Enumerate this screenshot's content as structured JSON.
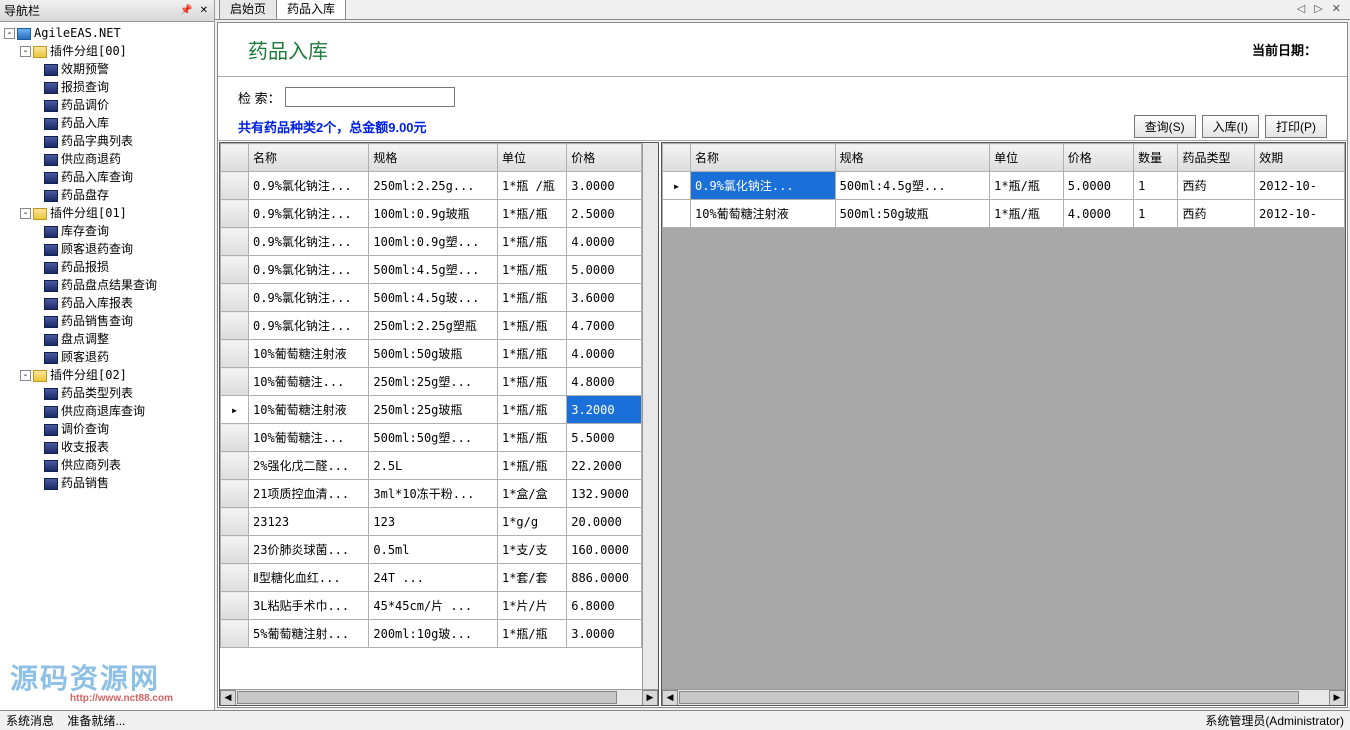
{
  "sidebar": {
    "title": "导航栏",
    "root": "AgileEAS.NET",
    "groups": [
      {
        "label": "插件分组[00]",
        "items": [
          "效期预警",
          "报损查询",
          "药品调价",
          "药品入库",
          "药品字典列表",
          "供应商退药",
          "药品入库查询",
          "药品盘存"
        ]
      },
      {
        "label": "插件分组[01]",
        "items": [
          "库存查询",
          "顾客退药查询",
          "药品报损",
          "药品盘点结果查询",
          "药品入库报表",
          "药品销售查询",
          "盘点调整",
          "顾客退药"
        ]
      },
      {
        "label": "插件分组[02]",
        "items": [
          "药品类型列表",
          "供应商退库查询",
          "调价查询",
          "收支报表",
          "供应商列表",
          "药品销售"
        ]
      }
    ]
  },
  "tabs": {
    "start": "启始页",
    "active": "药品入库"
  },
  "page": {
    "title": "药品入库",
    "date_label": "当前日期："
  },
  "search": {
    "label": "检  索：",
    "value": "",
    "summary": "共有药品种类2个，总金额9.00元"
  },
  "buttons": {
    "query": "查询(S)",
    "in": "入库(I)",
    "print": "打印(P)"
  },
  "left_grid": {
    "cols": [
      "名称",
      "规格",
      "单位",
      "价格"
    ],
    "rows": [
      {
        "name": "0.9%氯化钠注...",
        "spec": "250ml:2.25g...",
        "unit": "1*瓶 /瓶",
        "price": "3.0000"
      },
      {
        "name": "0.9%氯化钠注...",
        "spec": "100ml:0.9g玻瓶",
        "unit": "1*瓶/瓶",
        "price": "2.5000"
      },
      {
        "name": "0.9%氯化钠注...",
        "spec": "100ml:0.9g塑...",
        "unit": "1*瓶/瓶",
        "price": "4.0000"
      },
      {
        "name": "0.9%氯化钠注...",
        "spec": "500ml:4.5g塑...",
        "unit": "1*瓶/瓶",
        "price": "5.0000"
      },
      {
        "name": "0.9%氯化钠注...",
        "spec": "500ml:4.5g玻...",
        "unit": "1*瓶/瓶",
        "price": "3.6000"
      },
      {
        "name": "0.9%氯化钠注...",
        "spec": "250ml:2.25g塑瓶",
        "unit": "1*瓶/瓶",
        "price": "4.7000"
      },
      {
        "name": "10%葡萄糖注射液",
        "spec": "500ml:50g玻瓶",
        "unit": "1*瓶/瓶",
        "price": "4.0000"
      },
      {
        "name": "10%葡萄糖注...",
        "spec": "250ml:25g塑...",
        "unit": "1*瓶/瓶",
        "price": "4.8000"
      },
      {
        "name": "10%葡萄糖注射液",
        "spec": "250ml:25g玻瓶",
        "unit": "1*瓶/瓶",
        "price": "3.2000",
        "selected": true
      },
      {
        "name": "10%葡萄糖注...",
        "spec": "500ml:50g塑...",
        "unit": "1*瓶/瓶",
        "price": "5.5000"
      },
      {
        "name": "2%强化戊二醛...",
        "spec": "2.5L",
        "unit": "1*瓶/瓶",
        "price": "22.2000"
      },
      {
        "name": "21项质控血清...",
        "spec": "3ml*10冻干粉...",
        "unit": "1*盒/盒",
        "price": "132.9000"
      },
      {
        "name": "23123",
        "spec": "123",
        "unit": "1*g/g",
        "price": "20.0000"
      },
      {
        "name": "23价肺炎球菌...",
        "spec": "0.5ml",
        "unit": "1*支/支",
        "price": "160.0000"
      },
      {
        "name": "Ⅱ型糖化血红...",
        "spec": "24T      ...",
        "unit": "1*套/套",
        "price": "886.0000"
      },
      {
        "name": "3L粘贴手术巾...",
        "spec": "45*45cm/片 ...",
        "unit": "1*片/片",
        "price": "6.8000"
      },
      {
        "name": "5%葡萄糖注射...",
        "spec": "200ml:10g玻...",
        "unit": "1*瓶/瓶",
        "price": "3.0000"
      }
    ]
  },
  "right_grid": {
    "cols": [
      "名称",
      "规格",
      "单位",
      "价格",
      "数量",
      "药品类型",
      "效期"
    ],
    "rows": [
      {
        "name": "0.9%氯化钠注...",
        "spec": "500ml:4.5g塑...",
        "unit": "1*瓶/瓶",
        "price": "5.0000",
        "qty": "1",
        "type": "西药",
        "exp": "2012-10-",
        "hl": true
      },
      {
        "name": "10%葡萄糖注射液",
        "spec": "500ml:50g玻瓶",
        "unit": "1*瓶/瓶",
        "price": "4.0000",
        "qty": "1",
        "type": "西药",
        "exp": "2012-10-"
      }
    ]
  },
  "status": {
    "left1": "系统消息",
    "left2": "准备就绪...",
    "right": "系统管理员(Administrator)"
  },
  "watermark": {
    "text": "源码资源网",
    "url": "http://www.nct88.com"
  }
}
